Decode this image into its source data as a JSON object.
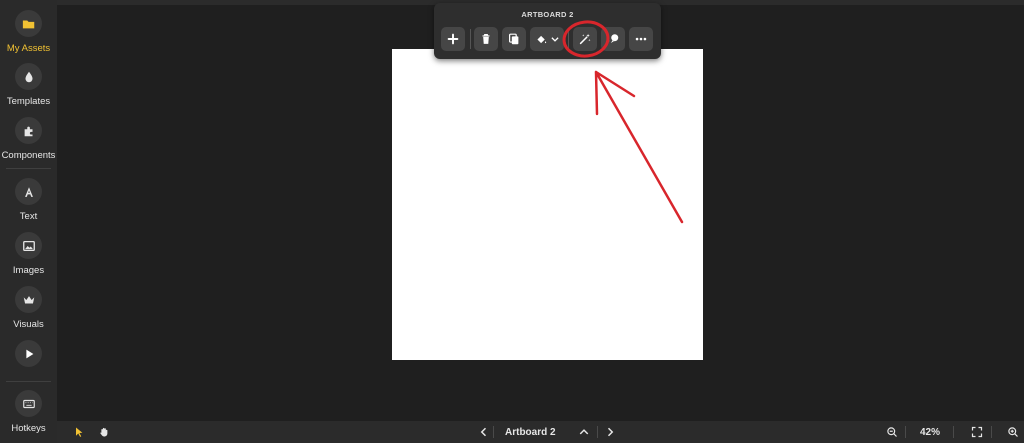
{
  "sidebar": {
    "items": [
      {
        "label": "My Assets",
        "icon": "folder-icon",
        "active": true
      },
      {
        "label": "Templates",
        "icon": "drop-icon"
      },
      {
        "label": "Components",
        "icon": "puzzle-icon"
      },
      {
        "label": "Text",
        "icon": "text-a-icon"
      },
      {
        "label": "Images",
        "icon": "image-icon"
      },
      {
        "label": "Visuals",
        "icon": "crown-icon"
      },
      {
        "label": "",
        "icon": "play-icon"
      },
      {
        "label": "Hotkeys",
        "icon": "keyboard-icon"
      }
    ]
  },
  "toolbar": {
    "title": "ARTBOARD 2",
    "buttons": [
      "add-icon",
      "trash-icon",
      "copy-icon",
      "fill-bucket-icon",
      "magic-wand-icon",
      "ai-chat-icon",
      "more-icon"
    ]
  },
  "bottombar": {
    "artboard_name": "Artboard 2",
    "zoom": "42%"
  },
  "colors": {
    "accent": "#f2c233",
    "annotation": "#d8262c",
    "canvas_bg": "#1f1f1f",
    "sidebar_bg": "#2a2a2a"
  }
}
